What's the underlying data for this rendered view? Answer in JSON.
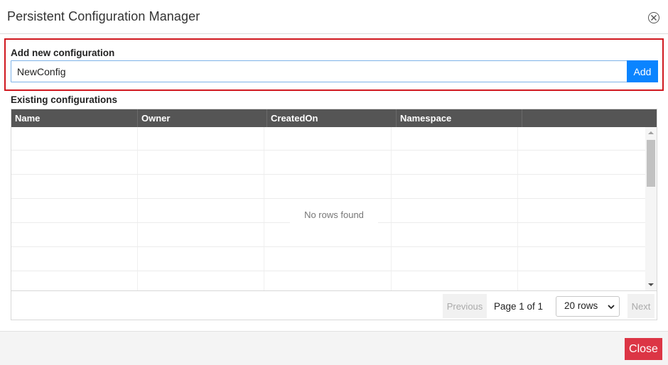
{
  "dialog": {
    "title": "Persistent Configuration Manager",
    "close_icon": "close-circle-icon"
  },
  "add_section": {
    "label": "Add new configuration",
    "input_value": "NewConfig",
    "add_label": "Add"
  },
  "existing": {
    "label": "Existing configurations",
    "columns": [
      "Name",
      "Owner",
      "CreatedOn",
      "Namespace",
      ""
    ],
    "empty_message": "No rows found"
  },
  "pager": {
    "previous_label": "Previous",
    "page_info": "Page 1 of 1",
    "rows_selected": "20 rows",
    "next_label": "Next"
  },
  "footer": {
    "close_label": "Close"
  },
  "colors": {
    "header_bg": "#555555",
    "add_button": "#0a84ff",
    "close_button": "#dc3545",
    "highlight_border": "#d0181f"
  }
}
